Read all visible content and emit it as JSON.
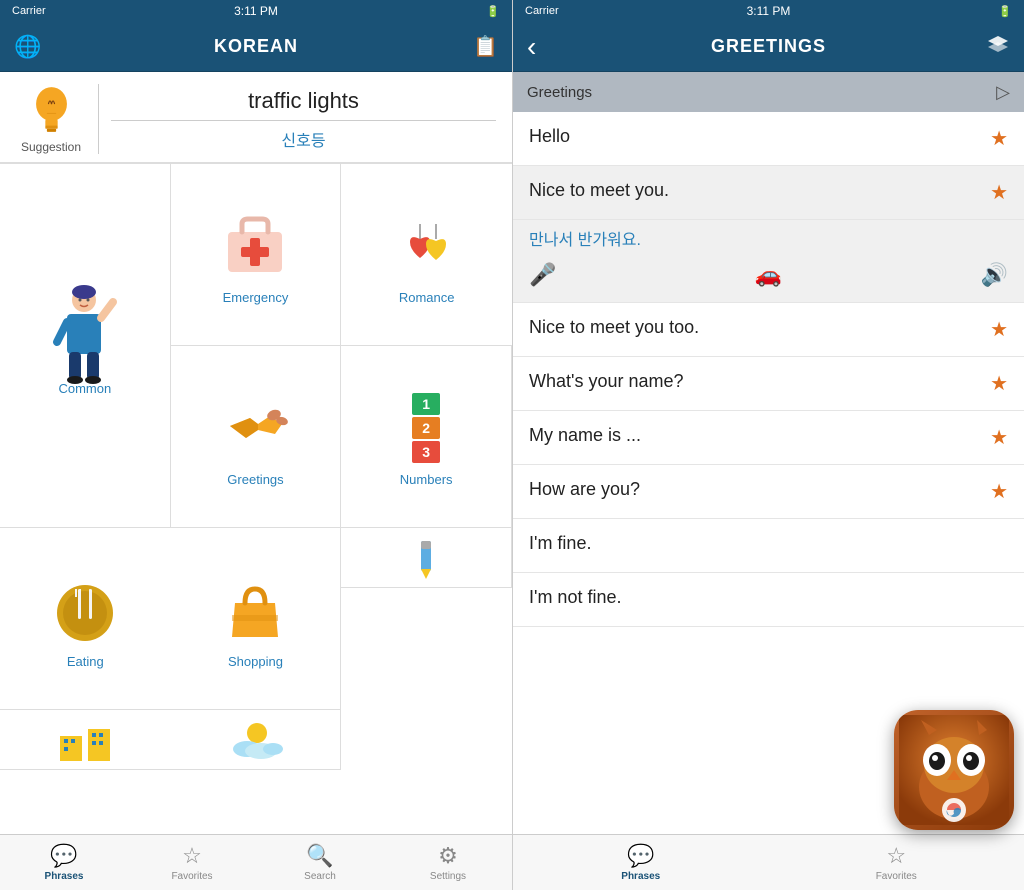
{
  "leftPhone": {
    "statusBar": {
      "carrier": "Carrier",
      "time": "3:11 PM",
      "battery": "▮▮▮"
    },
    "navBar": {
      "title": "KOREAN"
    },
    "suggestion": {
      "label": "Suggestion",
      "word": "traffic lights",
      "korean": "신호등"
    },
    "categories": [
      {
        "id": "common",
        "label": "Common",
        "icon": "person"
      },
      {
        "id": "emergency",
        "label": "Emergency",
        "icon": "emergency"
      },
      {
        "id": "romance",
        "label": "Romance",
        "icon": "romance"
      },
      {
        "id": "greetings",
        "label": "Greetings",
        "icon": "handshake"
      },
      {
        "id": "numbers",
        "label": "Numbers",
        "icon": "numbers"
      },
      {
        "id": "eating",
        "label": "Eating",
        "icon": "food"
      },
      {
        "id": "shopping",
        "label": "Shopping",
        "icon": "shopping"
      },
      {
        "id": "partial1",
        "label": "",
        "icon": "pencil"
      },
      {
        "id": "partial2",
        "label": "",
        "icon": "building"
      },
      {
        "id": "partial3",
        "label": "",
        "icon": "sun"
      }
    ],
    "tabs": [
      {
        "id": "phrases",
        "label": "Phrases",
        "icon": "💬",
        "active": true
      },
      {
        "id": "favorites",
        "label": "Favorites",
        "icon": "☆",
        "active": false
      },
      {
        "id": "search",
        "label": "Search",
        "icon": "🔍",
        "active": false
      },
      {
        "id": "settings",
        "label": "Settings",
        "icon": "⚙",
        "active": false
      }
    ]
  },
  "rightPhone": {
    "statusBar": {
      "carrier": "Carrier",
      "time": "3:11 PM",
      "battery": "▮▮▮"
    },
    "navBar": {
      "title": "GREETINGS",
      "backLabel": "‹"
    },
    "sectionHeader": {
      "label": "Greetings",
      "playIcon": "▷"
    },
    "phrases": [
      {
        "id": "hello",
        "text": "Hello",
        "star": true,
        "expanded": false
      },
      {
        "id": "nice-to-meet",
        "text": "Nice to meet you.",
        "star": true,
        "expanded": true,
        "translation": "만나서 반가워요."
      },
      {
        "id": "nice-to-meet-too",
        "text": "Nice to meet you too.",
        "star": true,
        "expanded": false
      },
      {
        "id": "whats-your-name",
        "text": "What's your name?",
        "star": true,
        "expanded": false
      },
      {
        "id": "my-name-is",
        "text": "My name is ...",
        "star": true,
        "expanded": false
      },
      {
        "id": "how-are-you",
        "text": "How are you?",
        "star": true,
        "expanded": false
      },
      {
        "id": "im-fine",
        "text": "I'm fine.",
        "star": false,
        "expanded": false
      },
      {
        "id": "im-not-fine",
        "text": "I'm not fine.",
        "star": false,
        "expanded": false
      }
    ],
    "tabs": [
      {
        "id": "phrases",
        "label": "Phrases",
        "icon": "💬",
        "active": true
      },
      {
        "id": "favorites",
        "label": "Favorites",
        "icon": "☆",
        "active": false
      }
    ]
  }
}
